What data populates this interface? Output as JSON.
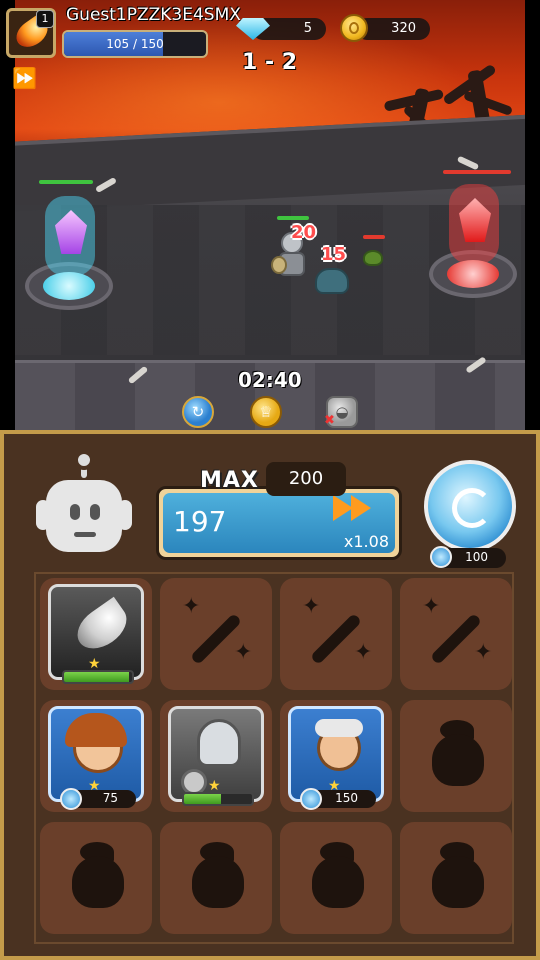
{
  "player": {
    "name": "Guest1PZZK3E4SMX",
    "level": "1",
    "hp_text": "105 / 150",
    "hp_fraction": 0.7
  },
  "currency": {
    "gems": "5",
    "coins": "320"
  },
  "stage": "1 - 2",
  "battle": {
    "timer": "02:40",
    "damage_1": "20",
    "damage_2": "15"
  },
  "energy": {
    "max_label": "MAX",
    "max_value": "200",
    "current": "197",
    "multiplier": "x1.08"
  },
  "summon_orb": {
    "cost": "100"
  },
  "slots": [
    {
      "kind": "skill",
      "icon": "meteor-icon",
      "progress": 0.95
    },
    {
      "kind": "empty-skill",
      "icon": "magic-wand-icon"
    },
    {
      "kind": "empty-skill",
      "icon": "magic-wand-icon"
    },
    {
      "kind": "empty-skill",
      "icon": "magic-wand-icon"
    },
    {
      "kind": "hero",
      "icon": "hero-girl-icon",
      "cost": "75"
    },
    {
      "kind": "hero",
      "icon": "knight-icon",
      "progress": 0.55
    },
    {
      "kind": "hero",
      "icon": "crossbowman-icon",
      "cost": "150"
    },
    {
      "kind": "locked-hero",
      "icon": "helmet-icon"
    },
    {
      "kind": "locked-hero",
      "icon": "helmet-icon"
    },
    {
      "kind": "locked-hero",
      "icon": "helmet-icon"
    },
    {
      "kind": "locked-hero",
      "icon": "helmet-icon"
    },
    {
      "kind": "locked-hero",
      "icon": "helmet-icon"
    }
  ],
  "colors": {
    "panel_bg": "#4a3221",
    "panel_border": "#c49b4a",
    "energy_blue": "#2b86bd",
    "hp_blue": "#2d57b0",
    "progress_green": "#3f9a1f"
  }
}
